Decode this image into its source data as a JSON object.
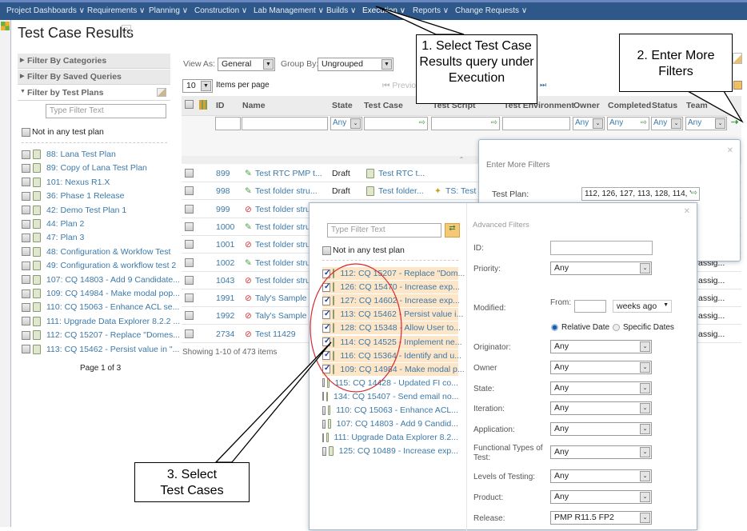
{
  "nav": {
    "items": [
      "Project Dashboards ∨",
      "Requirements ∨",
      "Planning ∨",
      "Construction ∨",
      "Lab Management ∨",
      "Builds ∨",
      "Execution ∨",
      "Reports ∨",
      "Change Requests ∨"
    ]
  },
  "page": {
    "title": "Test Case Results",
    "help": "?"
  },
  "left": {
    "sections": [
      "Filter By Categories",
      "Filter By Saved Queries",
      "Filter by Test Plans"
    ],
    "filter_placeholder": "Type Filter Text",
    "not_in_plan": "Not in any test plan",
    "plans": [
      "88: Lana Test Plan",
      "89: Copy of Lana Test Plan",
      "101: Nexus R1.X",
      "36: Phase 1 Release",
      "42: Demo Test Plan 1",
      "44: Plan 2",
      "47: Plan 3",
      "48: Configuration & Workfow Test",
      "49: Configuration & workflow test 2",
      "107: CQ 14803 - Add 9 Candidate...",
      "109: CQ 14984 - Make modal pop...",
      "110: CQ 15063 - Enhance ACL se...",
      "111: Upgrade Data Explorer 8.2.2 ...",
      "112: CQ 15207 - Replace \"Domes...",
      "113: CQ 15462 - Persist value in \"..."
    ],
    "pager": "Page 1 of 3"
  },
  "main": {
    "view_as_label": "View As:",
    "view_as": "General",
    "group_by_label": "Group By:",
    "group_by": "Ungrouped",
    "per_page": "10",
    "per_page_label": "Items per page",
    "previous": "Previous",
    "columns": [
      "ID",
      "Name",
      "State",
      "Test Case",
      "Test Script",
      "Test Environment",
      "Owner",
      "Completed",
      "Status",
      "Team"
    ],
    "any": "Any",
    "rows": [
      {
        "id": "899",
        "name": "Test RTC PMP t...",
        "state": "Draft",
        "tc": "Test RTC t...",
        "ts": "",
        "status": "ok"
      },
      {
        "id": "998",
        "name": "Test folder stru...",
        "state": "Draft",
        "tc": "Test folder...",
        "ts": "TS: Test f",
        "status": "ok"
      },
      {
        "id": "999",
        "name": "Test folder stru...",
        "state": "",
        "tc": "",
        "ts": "",
        "status": "err"
      },
      {
        "id": "1000",
        "name": "Test folder stru...",
        "state": "",
        "tc": "",
        "ts": "",
        "status": "ok"
      },
      {
        "id": "1001",
        "name": "Test folder stru...",
        "state": "",
        "tc": "",
        "ts": "",
        "status": "err"
      },
      {
        "id": "1002",
        "name": "Test folder stru...",
        "state": "",
        "tc": "",
        "ts": "",
        "status": "ok"
      },
      {
        "id": "1043",
        "name": "Test folder stru...",
        "state": "",
        "tc": "",
        "ts": "",
        "status": "err"
      },
      {
        "id": "1991",
        "name": "Taly's Sample T...",
        "state": "",
        "tc": "",
        "ts": "",
        "status": "err"
      },
      {
        "id": "1992",
        "name": "Taly's Sample T...",
        "state": "",
        "tc": "",
        "ts": "",
        "status": "err"
      },
      {
        "id": "2734",
        "name": "Test 11429",
        "state": "",
        "tc": "",
        "ts": "",
        "status": "err"
      }
    ],
    "assig": "assig...",
    "showing": "Showing 1-10 of 473 items"
  },
  "more_filters": {
    "title": "Enter More Filters",
    "test_plan_label": "Test Plan:",
    "test_plan_value": "112, 126, 127, 113, 128, 114, '"
  },
  "advanced": {
    "filter_placeholder": "Type Filter Text",
    "not_in_plan": "Not in any test plan",
    "plans": [
      {
        "label": "112: CQ 15207 - Replace \"Dom...",
        "checked": true
      },
      {
        "label": "126: CQ 15470 - Increase exp...",
        "checked": true
      },
      {
        "label": "127: CQ 14602 - Increase exp...",
        "checked": true
      },
      {
        "label": "113: CQ 15462 - Persist value i...",
        "checked": true
      },
      {
        "label": "128: CQ 15348 - Allow User to...",
        "checked": true
      },
      {
        "label": "114: CQ 14525 - Implement ne...",
        "checked": true
      },
      {
        "label": "116: CQ 15364 - Identify and u...",
        "checked": true
      },
      {
        "label": "109: CQ 14984 - Make modal p...",
        "checked": true
      },
      {
        "label": "115: CQ 14428 - Updated FI co...",
        "checked": false
      },
      {
        "label": "134: CQ 15407 - Send email no...",
        "checked": false
      },
      {
        "label": "110: CQ 15063 - Enhance ACL...",
        "checked": false
      },
      {
        "label": "107: CQ 14803 - Add 9 Candid...",
        "checked": false
      },
      {
        "label": "111: Upgrade Data Explorer 8.2...",
        "checked": false
      },
      {
        "label": "125: CQ 10489 - Increase exp...",
        "checked": false
      }
    ],
    "title": "Advanced Filters",
    "id_label": "ID:",
    "priority_label": "Priority:",
    "priority": "Any",
    "modified_label": "Modified:",
    "from_label": "From:",
    "weeks_ago": "weeks ago",
    "relative": "Relative Date",
    "specific": "Specific Dates",
    "fields": [
      {
        "label": "Originator:",
        "value": "Any"
      },
      {
        "label": "Owner",
        "value": "Any"
      },
      {
        "label": "State:",
        "value": "Any"
      },
      {
        "label": "Iteration:",
        "value": "Any"
      },
      {
        "label": "Application:",
        "value": "Any"
      },
      {
        "label": "Functional Types of Test:",
        "value": "Any"
      },
      {
        "label": "Levels of Testing:",
        "value": "Any"
      },
      {
        "label": "Product:",
        "value": "Any"
      },
      {
        "label": "Release:",
        "value": "PMP R11.5 FP2"
      }
    ]
  },
  "callouts": [
    "1.  Select Test Case Results query under Execution",
    "2. Enter More Filters",
    "3. Select Test Cases"
  ],
  "colors": {
    "nav": "#2d5889",
    "link": "#3c79a8",
    "highlight": "#fde5c8",
    "annotation_ellipse": "#d9262c"
  }
}
